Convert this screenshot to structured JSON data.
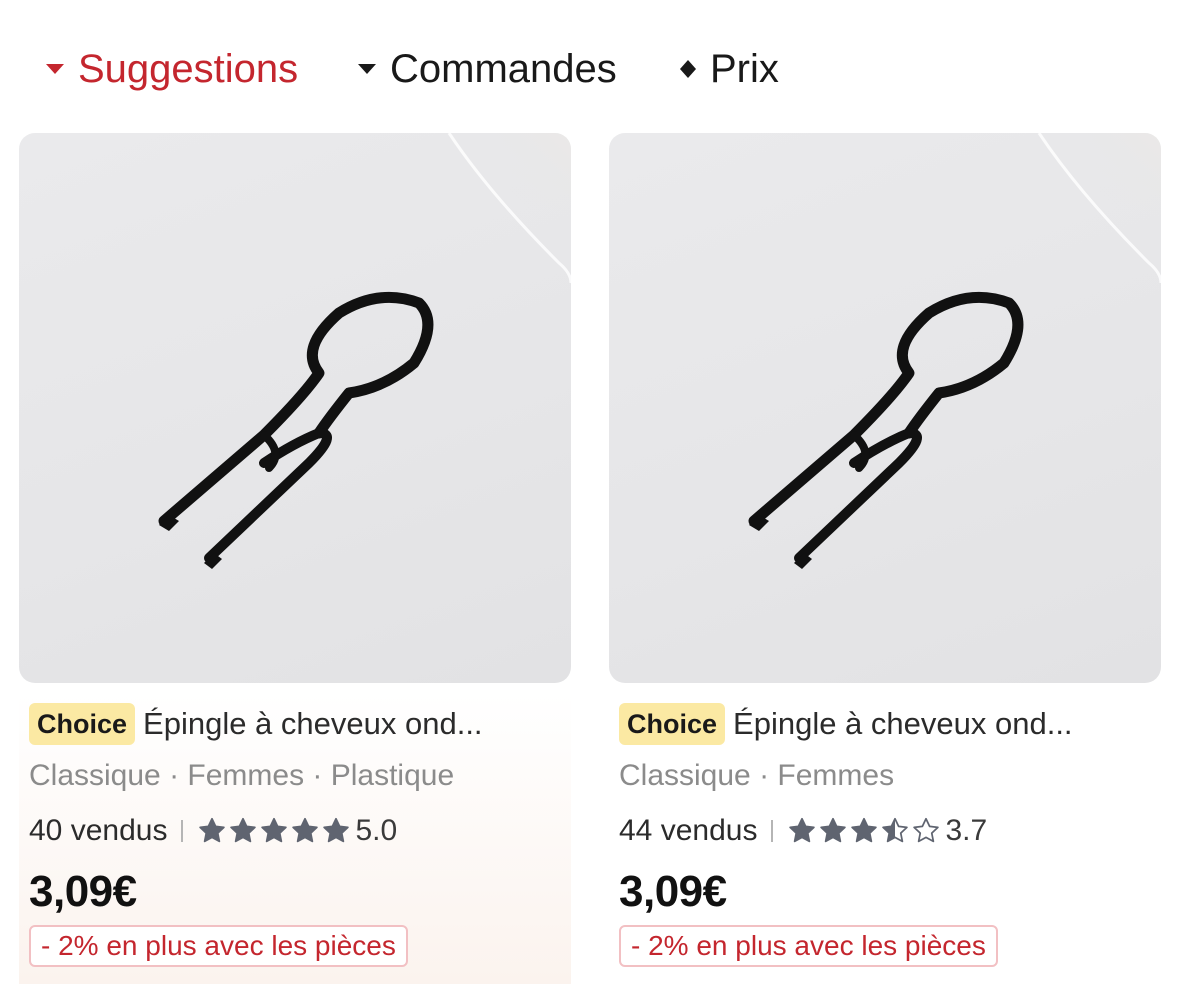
{
  "sort": {
    "suggestions": "Suggestions",
    "commandes": "Commandes",
    "prix": "Prix",
    "active_color": "#c4262e"
  },
  "products": [
    {
      "badge": "Choice",
      "title": "Épingle à cheveux ond...",
      "attributes": "Classique · Femmes · Plastique",
      "sold": "40 vendus",
      "rating": "5.0",
      "stars": 5.0,
      "price": "3,09€",
      "promo": "- 2% en plus avec les pièces"
    },
    {
      "badge": "Choice",
      "title": "Épingle à cheveux ond...",
      "attributes": "Classique · Femmes",
      "sold": "44 vendus",
      "rating": "3.7",
      "stars": 3.5,
      "price": "3,09€",
      "promo": "- 2% en plus avec les pièces"
    }
  ],
  "colors": {
    "accent_red": "#c4262e",
    "choice_badge_bg": "#fbe9a3",
    "star": "#5f6470"
  },
  "icons": {
    "sort_active": "caret-down-icon",
    "sort_orders": "caret-down-icon",
    "sort_price": "sort-updown-icon",
    "star": "star-icon"
  }
}
